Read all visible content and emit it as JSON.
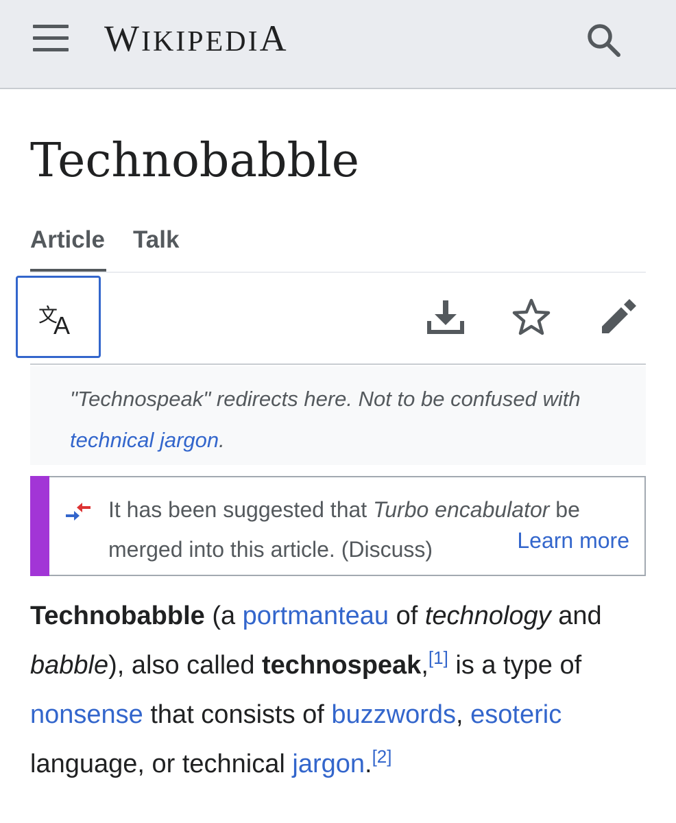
{
  "header": {
    "wordmark": "WIKIPEDIA",
    "menu_icon": "hamburger-menu-icon",
    "search_icon": "search-icon"
  },
  "page": {
    "title": "Technobabble"
  },
  "tabs": [
    {
      "label": "Article",
      "selected": true
    },
    {
      "label": "Talk",
      "selected": false
    }
  ],
  "toolbar": {
    "language_icon": "language-icon",
    "download_icon": "download-icon",
    "watch_icon": "star-icon",
    "edit_icon": "pencil-icon"
  },
  "hatnote": {
    "text_before": "\"Technospeak\" redirects here. Not to be confused with ",
    "link": "technical jargon",
    "text_after": "."
  },
  "merge_notice": {
    "text_before": "It has been suggested that ",
    "italic": "Turbo encabulator",
    "text_after": " be merged into this article. (Discuss)",
    "learn_more": "Learn more",
    "accent_color": "#a235d6"
  },
  "lead": {
    "term": "Technobabble",
    "t1": " (a ",
    "link_portmanteau": "portmanteau",
    "t2": " of ",
    "italic_technology": "technology",
    "t3": " and ",
    "italic_babble": "babble",
    "t4": "), also called ",
    "bold_technospeak": "technospeak",
    "t5": ",",
    "ref1": "[1]",
    "t6": " is a type of ",
    "link_nonsense": "nonsense",
    "t7": " that consists of ",
    "link_buzzwords": "buzzwords",
    "t8": ", ",
    "link_esoteric": "esoteric",
    "t9": " language, or technical ",
    "link_jargon": "jargon",
    "t10": ".",
    "ref2": "[2]"
  },
  "colors": {
    "link": "#3366cc",
    "header_bg": "#eaecf0",
    "text": "#202122"
  }
}
